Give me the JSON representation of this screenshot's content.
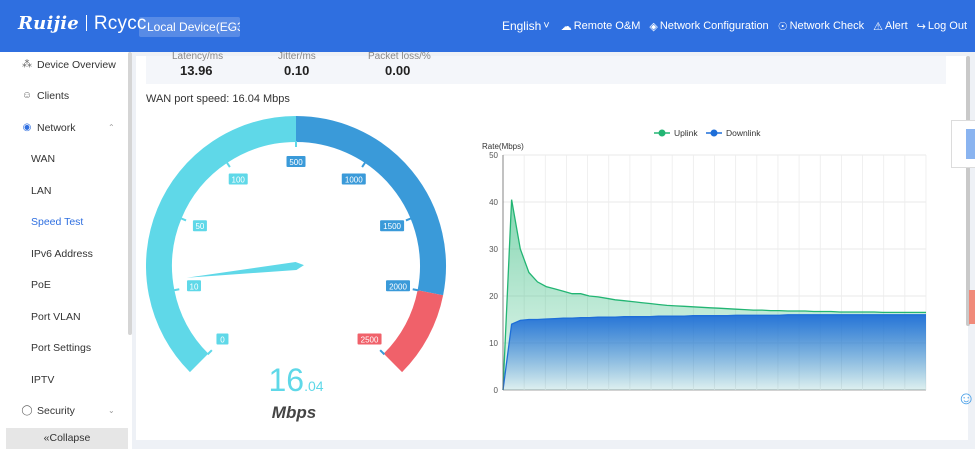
{
  "header": {
    "brand": "Ruijie",
    "brand_sub": "Rcycc",
    "device_select": "Local Device(EG3",
    "language": "English",
    "nav": {
      "remote": "Remote O&M",
      "network_config": "Network Configuration",
      "network_check": "Network Check",
      "alert": "Alert",
      "logout": "Log Out"
    }
  },
  "sidebar": {
    "items": [
      {
        "label": "Device Overview",
        "icon": "topology-icon"
      },
      {
        "label": "Clients",
        "icon": "user-icon"
      },
      {
        "label": "Network",
        "icon": "globe-icon",
        "expanded": true
      },
      {
        "label": "WAN"
      },
      {
        "label": "LAN"
      },
      {
        "label": "Speed Test",
        "active": true
      },
      {
        "label": "IPv6 Address"
      },
      {
        "label": "PoE"
      },
      {
        "label": "Port VLAN"
      },
      {
        "label": "Port Settings"
      },
      {
        "label": "IPTV"
      },
      {
        "label": "Security",
        "icon": "shield-icon"
      }
    ],
    "collapse": "Collapse"
  },
  "metrics": [
    {
      "label": "Latency/ms",
      "value": "13.96"
    },
    {
      "label": "Jitter/ms",
      "value": "0.10"
    },
    {
      "label": "Packet loss/%",
      "value": "0.00"
    }
  ],
  "wan_speed_label": "WAN port speed: 16.04 Mbps",
  "gauge": {
    "value": 16.04,
    "value_int": "16",
    "value_dec": ".04",
    "unit": "Mbps",
    "ticks": [
      "0",
      "10",
      "50",
      "100",
      "500",
      "1000",
      "1500",
      "2000",
      "2500"
    ],
    "colors": {
      "low": "#5fd8e8",
      "high": "#3a9ad9",
      "danger": "#f0616a"
    }
  },
  "chart_data": {
    "type": "area",
    "ylabel": "Rate(Mbps)",
    "ylim": [
      0,
      50
    ],
    "yticks": [
      "0",
      "10",
      "20",
      "30",
      "40",
      "50"
    ],
    "series": [
      {
        "name": "Uplink",
        "color": "#22b573",
        "values": [
          0,
          40.5,
          30,
          25,
          23,
          22,
          21.5,
          21,
          20.5,
          20.5,
          20,
          19.8,
          19.5,
          19.2,
          19,
          18.8,
          18.6,
          18.4,
          18.2,
          18,
          17.9,
          17.8,
          17.7,
          17.6,
          17.5,
          17.4,
          17.3,
          17.2,
          17.1,
          17,
          17,
          16.9,
          16.9,
          16.8,
          16.8,
          16.8,
          16.7,
          16.7,
          16.7,
          16.6,
          16.6,
          16.6,
          16.6,
          16.6,
          16.5,
          16.5,
          16.5,
          16.5,
          16.5,
          16.5
        ]
      },
      {
        "name": "Downlink",
        "color": "#1e6ed8",
        "values": [
          0,
          14,
          14.8,
          15,
          15,
          15.1,
          15.2,
          15.3,
          15.3,
          15.4,
          15.4,
          15.5,
          15.5,
          15.5,
          15.6,
          15.6,
          15.6,
          15.6,
          15.7,
          15.7,
          15.7,
          15.7,
          15.8,
          15.8,
          15.8,
          15.8,
          15.8,
          15.9,
          15.9,
          15.9,
          15.9,
          15.9,
          15.9,
          16,
          16,
          16,
          16,
          16,
          16,
          16,
          16,
          16,
          16,
          16,
          16,
          16,
          16,
          16,
          16,
          16
        ]
      }
    ]
  }
}
